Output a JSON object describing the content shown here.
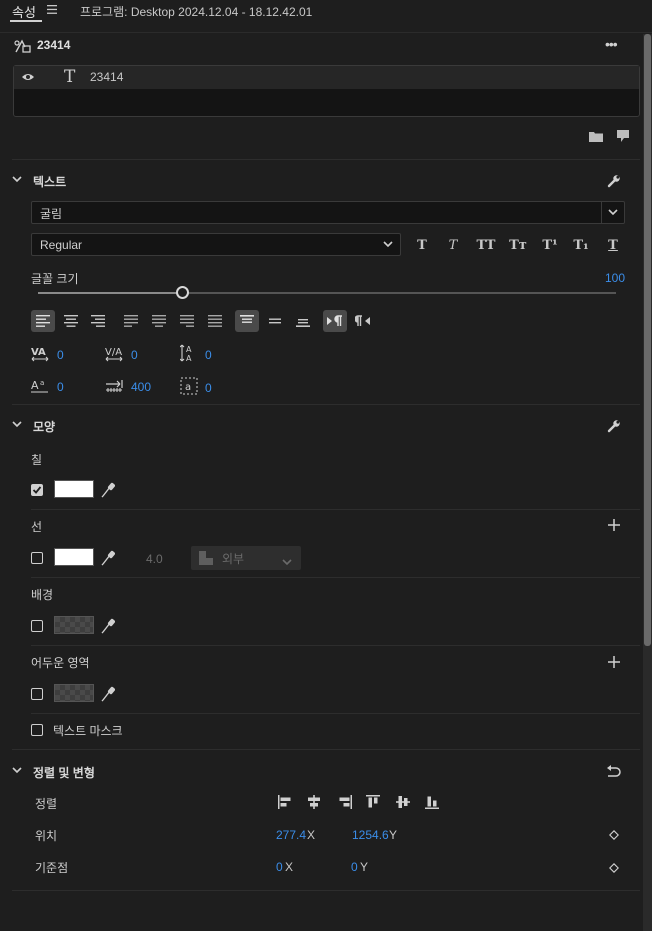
{
  "tabs": {
    "properties": "속성",
    "menu_icon": "hamburger-icon",
    "program": "프로그램: Desktop 2024.12.04 - 18.12.42.01"
  },
  "layer": {
    "name": "23414",
    "more": "•••",
    "item_name": "23414"
  },
  "text_section": {
    "title": "텍스트",
    "font": "굴림",
    "style": "Regular",
    "style_buttons": [
      "T",
      "T",
      "TT",
      "Tт",
      "T¹",
      "T₁",
      "T"
    ],
    "font_size_label": "글꼴 크기",
    "font_size_value": "100",
    "font_size_fraction": 0.25,
    "kerning": "0",
    "tracking": "0",
    "leading": "0",
    "baseline_shift": "0",
    "tab_width": "400",
    "tsume": "0"
  },
  "appearance": {
    "title": "모양",
    "fill_label": "칠",
    "stroke_label": "선",
    "stroke_width": "4.0",
    "stroke_position": "외부",
    "background_label": "배경",
    "shadow_label": "어두운 영역",
    "mask_label": "텍스트 마스크"
  },
  "transform": {
    "title": "정렬 및 변형",
    "align_label": "정렬",
    "position_label": "위치",
    "position_x": "277.4",
    "position_y": "1254.6",
    "anchor_label": "기준점",
    "anchor_x": "0",
    "anchor_y": "0",
    "x_suffix": "X",
    "y_suffix": "Y"
  },
  "colors": {
    "accent": "#3b8eea",
    "panel": "#1e1e1e",
    "white_swatch": "#ffffff"
  }
}
